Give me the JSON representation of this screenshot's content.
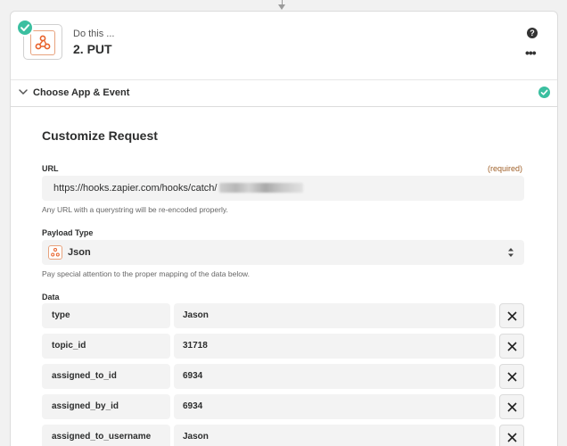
{
  "step": {
    "subtitle": "Do this ...",
    "title": "2. PUT",
    "help_icon": "question-mark-icon",
    "more_icon": "more-dots-icon",
    "app_icon": "webhook-icon"
  },
  "section": {
    "title": "Choose App & Event",
    "status": "complete"
  },
  "form": {
    "heading": "Customize Request",
    "url": {
      "label": "URL",
      "required_text": "(required)",
      "value": "https://hooks.zapier.com/hooks/catch/",
      "hint": "Any URL with a querystring will be re-encoded properly."
    },
    "payload": {
      "label": "Payload Type",
      "value": "Json",
      "hint": "Pay special attention to the proper mapping of the data below."
    },
    "data": {
      "label": "Data",
      "rows": [
        {
          "key": "type",
          "value": "Jason"
        },
        {
          "key": "topic_id",
          "value": "31718"
        },
        {
          "key": "assigned_to_id",
          "value": "6934"
        },
        {
          "key": "assigned_by_id",
          "value": "6934"
        },
        {
          "key": "assigned_to_username",
          "value": "Jason"
        }
      ]
    }
  },
  "colors": {
    "accent_teal": "#3bbfa0",
    "webhook_orange": "#e8612a",
    "required_text": "#a0612a"
  }
}
